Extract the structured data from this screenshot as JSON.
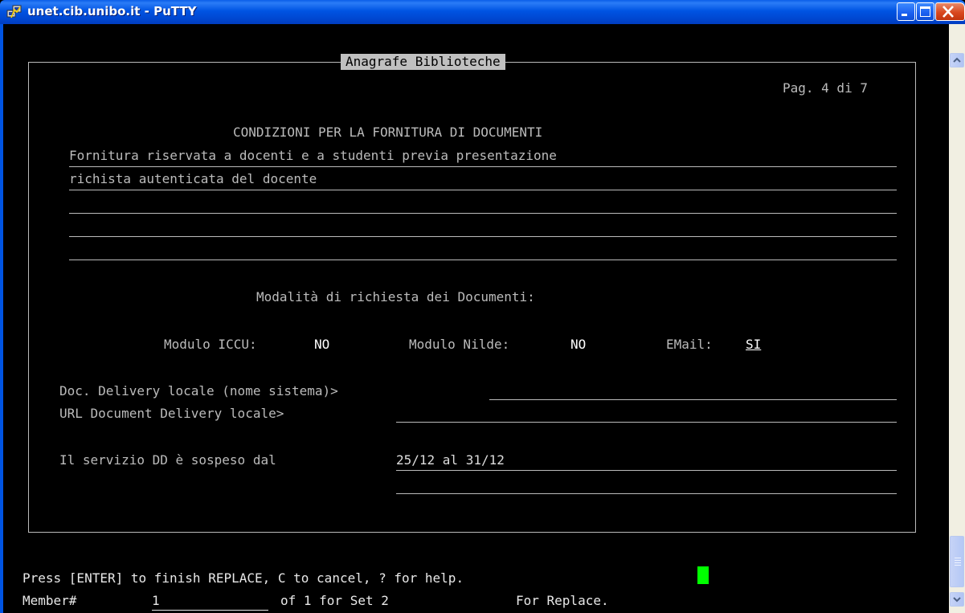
{
  "window": {
    "title": "unet.cib.unibo.it - PuTTY"
  },
  "screen": {
    "frame_title": "Anagrafe Biblioteche",
    "page_indicator": "Pag. 4 di 7",
    "section_title": "CONDIZIONI PER LA FORNITURA DI DOCUMENTI",
    "conditions": [
      "Fornitura riservata a docenti e a studenti previa presentazione",
      "richista autenticata del docente",
      "",
      "",
      ""
    ],
    "modalita_title": "Modalità di richiesta dei Documenti:",
    "modulo_iccu_label": "Modulo ICCU:",
    "modulo_iccu_value": "NO",
    "modulo_nilde_label": "Modulo Nilde:",
    "modulo_nilde_value": "NO",
    "email_label": "EMail:",
    "email_value": "SI",
    "dd_locale_label": "Doc. Delivery locale (nome sistema)>",
    "dd_locale_value": "",
    "url_dd_label": "URL Document Delivery locale>",
    "url_dd_value": "",
    "suspended_label": "Il servizio DD è sospeso dal",
    "suspended_value_1": "25/12 al 31/12",
    "suspended_value_2": ""
  },
  "status": {
    "prompt": "Press [ENTER] to finish REPLACE, C to cancel, ? for help.",
    "member_label": "Member#",
    "member_value": "1",
    "member_of": "of 1 for Set 2",
    "for_replace": "For Replace."
  }
}
